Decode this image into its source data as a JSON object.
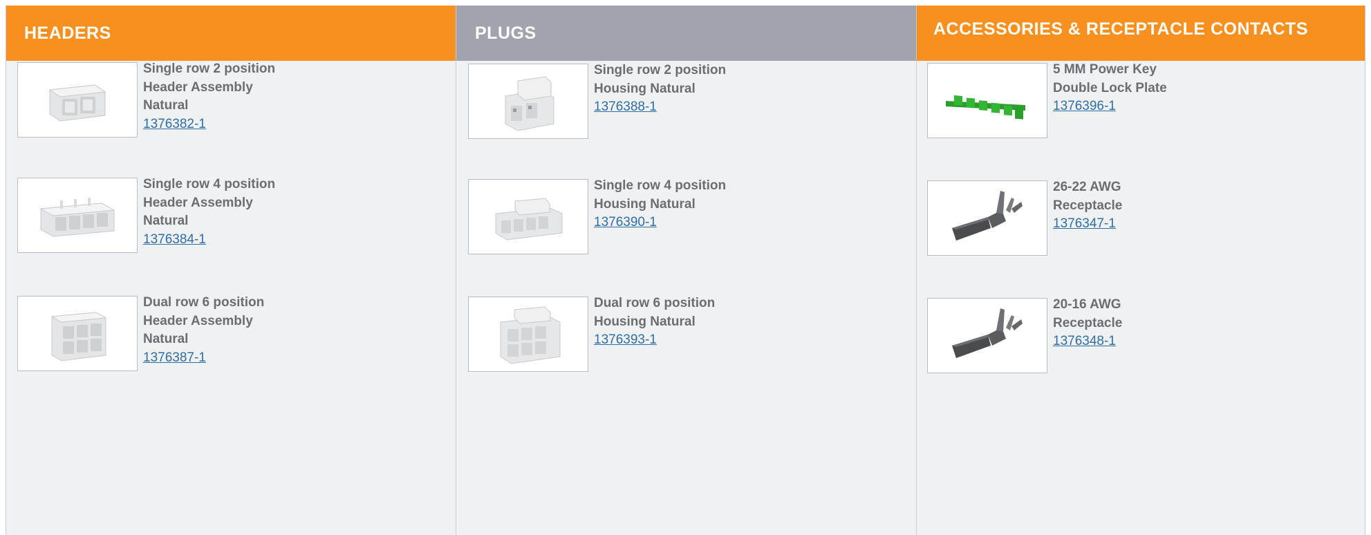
{
  "columns": [
    {
      "title": "HEADERS",
      "items": [
        {
          "lines": [
            "Single row 2 position",
            "Header Assembly",
            "Natural"
          ],
          "part": "1376382-1",
          "icon": "header-2pos-image"
        },
        {
          "lines": [
            "Single row 4 position",
            "Header Assembly",
            "Natural"
          ],
          "part": "1376384-1",
          "icon": "header-4pos-image"
        },
        {
          "lines": [
            "Dual row 6 position",
            "Header Assembly",
            "Natural"
          ],
          "part": "1376387-1",
          "icon": "header-6pos-image"
        }
      ]
    },
    {
      "title": "PLUGS",
      "items": [
        {
          "lines": [
            "Single row 2 position",
            "Housing Natural"
          ],
          "part": "1376388-1",
          "icon": "housing-2pos-image"
        },
        {
          "lines": [
            "Single row 4 position",
            "Housing Natural"
          ],
          "part": "1376390-1",
          "icon": "housing-4pos-image"
        },
        {
          "lines": [
            "Dual row 6 position",
            "Housing Natural"
          ],
          "part": "1376393-1",
          "icon": "housing-6pos-image"
        }
      ]
    },
    {
      "title": "ACCESSORIES & RECEPTACLE CONTACTS",
      "items": [
        {
          "lines": [
            "5 MM Power Key",
            "Double Lock Plate"
          ],
          "part": "1376396-1",
          "icon": "lock-plate-image"
        },
        {
          "lines": [
            "26-22 AWG",
            "Receptacle"
          ],
          "part": "1376347-1",
          "icon": "receptacle-contact-image"
        },
        {
          "lines": [
            "20-16 AWG",
            "Receptacle"
          ],
          "part": "1376348-1",
          "icon": "receptacle-contact-image"
        }
      ]
    }
  ],
  "colors": {
    "orange": "#f7901e",
    "gray_header": "#a2a3ac",
    "panel": "#f0f1f3",
    "link": "#2f6ea5",
    "text": "#6b6d72"
  }
}
